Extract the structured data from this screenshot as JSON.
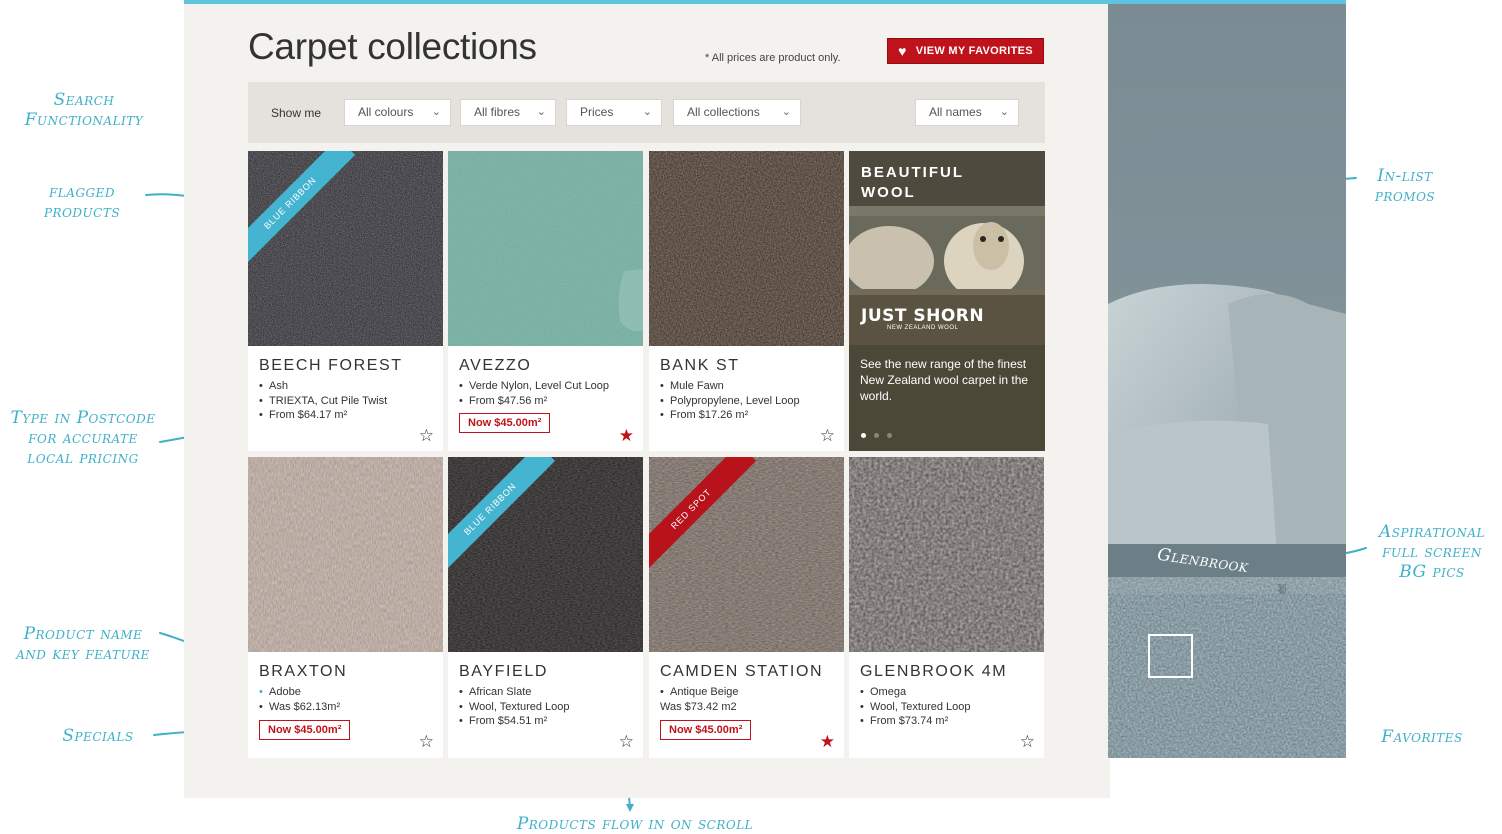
{
  "header": {
    "title": "Carpet collections",
    "price_note": "* All prices are product only.",
    "favorites_button": "VIEW MY FAVORITES"
  },
  "filters": {
    "label": "Show me",
    "colours": "All colours",
    "fibres": "All fibres",
    "prices": "Prices",
    "collections": "All collections",
    "names": "All names"
  },
  "products": [
    {
      "name": "BEECH FOREST",
      "ribbon": "BLUE RIBBON",
      "features": [
        "Ash",
        "TRIEXTA, Cut Pile Twist",
        "From $64.17 m²"
      ],
      "special": "",
      "favorite": false
    },
    {
      "name": "AVEZZO",
      "ribbon": "",
      "features": [
        "Verde Nylon, Level Cut Loop",
        "From $47.56 m²"
      ],
      "special": "Now $45.00m²",
      "favorite": true
    },
    {
      "name": "BANK ST",
      "ribbon": "",
      "features": [
        "Mule Fawn",
        "Polypropylene, Level Loop",
        "From $17.26 m²"
      ],
      "special": "",
      "favorite": false
    },
    {
      "name": "BRAXTON",
      "ribbon": "",
      "features": [
        "Adobe",
        "Was $62.13m²"
      ],
      "special": "Now $45.00m²",
      "favorite": false
    },
    {
      "name": "BAYFIELD",
      "ribbon": "BLUE RIBBON",
      "features": [
        "African Slate",
        "Wool, Textured Loop",
        "From $54.51 m²"
      ],
      "special": "",
      "favorite": false
    },
    {
      "name": "CAMDEN STATION",
      "ribbon": "RED SPOT",
      "features": [
        "Antique Beige",
        "Was $73.42 m2"
      ],
      "special": "Now $45.00m²",
      "favorite": true
    },
    {
      "name": "GLENBROOK 4M",
      "ribbon": "",
      "features": [
        "Omega",
        "Wool, Textured Loop",
        "From $73.74 m²"
      ],
      "special": "",
      "favorite": false
    }
  ],
  "promo": {
    "title_line1": "BEAUTIFUL",
    "title_line2": "WOOL",
    "brand": "JUST SHORN",
    "brand_sub": "NEW ZEALAND WOOL",
    "text": "See the new range of the finest New Zealand wool carpet in the world."
  },
  "background": {
    "label": "Glenbrook"
  },
  "annotations": {
    "search": [
      "Search",
      "Functionality"
    ],
    "flagged": [
      "flagged",
      "products"
    ],
    "postcode": [
      "Type in Postcode",
      "for accurate",
      "local pricing"
    ],
    "product_name": [
      "Product name",
      "and key feature"
    ],
    "specials": "Specials",
    "scroll": "Products flow in on scroll",
    "promos": [
      "In-list",
      "promos"
    ],
    "aspirational": [
      "Aspirational",
      "full screen",
      "BG pics"
    ],
    "favorites": "Favorites"
  },
  "colors": {
    "accent": "#5fc4de",
    "brand_red": "#c0121b",
    "annotation": "#3fb0c9",
    "panel_bg": "#f4f2ef"
  }
}
